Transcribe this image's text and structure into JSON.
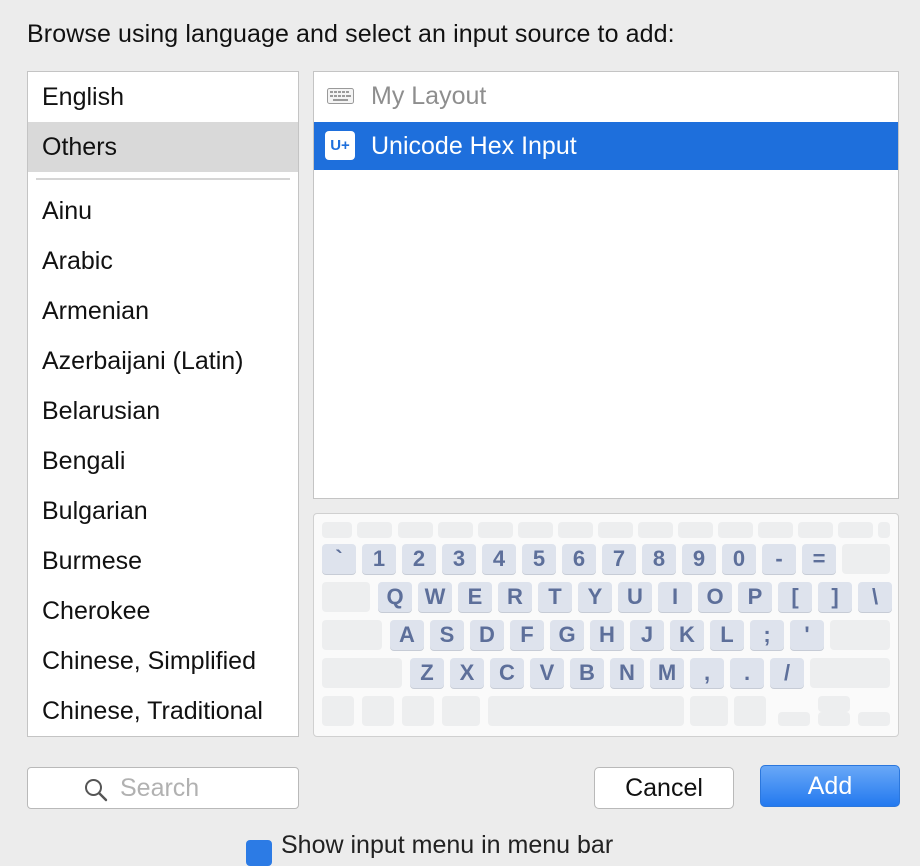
{
  "dialog": {
    "prompt": "Browse using language and select an input source to add:"
  },
  "languages": {
    "top": [
      {
        "label": "English",
        "selected": false
      },
      {
        "label": "Others",
        "selected": true
      }
    ],
    "items": [
      "Ainu",
      "Arabic",
      "Armenian",
      "Azerbaijani (Latin)",
      "Belarusian",
      "Bengali",
      "Bulgarian",
      "Burmese",
      "Cherokee",
      "Chinese, Simplified",
      "Chinese, Traditional"
    ]
  },
  "sources": [
    {
      "label": "My Layout",
      "icon": "keyboard-icon",
      "selected": false
    },
    {
      "label": "Unicode Hex Input",
      "icon": "unicode-plus-icon",
      "icon_text": "U+",
      "selected": true
    }
  ],
  "keyboard": {
    "rows": [
      [
        "`",
        "1",
        "2",
        "3",
        "4",
        "5",
        "6",
        "7",
        "8",
        "9",
        "0",
        "-",
        "="
      ],
      [
        "Q",
        "W",
        "E",
        "R",
        "T",
        "Y",
        "U",
        "I",
        "O",
        "P",
        "[",
        "]",
        "\\"
      ],
      [
        "A",
        "S",
        "D",
        "F",
        "G",
        "H",
        "J",
        "K",
        "L",
        ";",
        "'"
      ],
      [
        "Z",
        "X",
        "C",
        "V",
        "B",
        "N",
        "M",
        ",",
        ".",
        "/"
      ]
    ]
  },
  "search": {
    "placeholder": "Search"
  },
  "buttons": {
    "cancel": "Cancel",
    "add": "Add"
  },
  "background": {
    "checkbox_label": "Show input menu in menu bar",
    "checked": true
  },
  "colors": {
    "accent": "#1e6fdc",
    "key_text": "#5d6f9a"
  }
}
